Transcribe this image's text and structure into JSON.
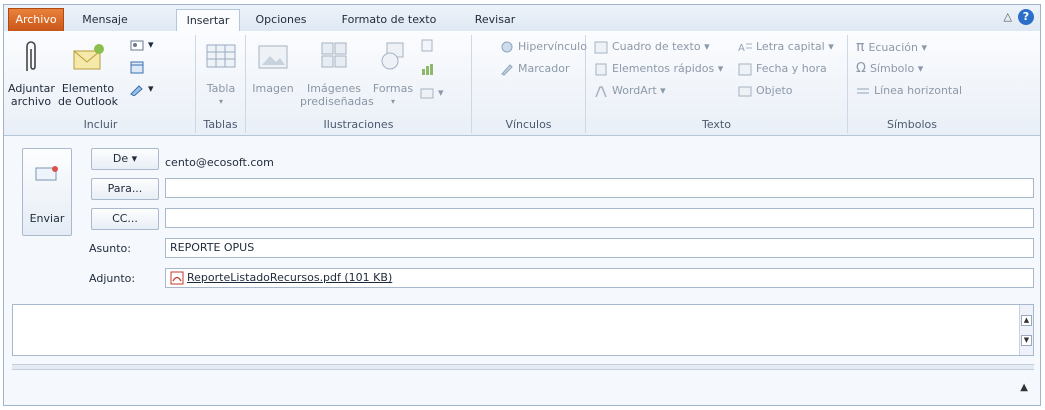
{
  "tabs": [
    {
      "label": "Archivo",
      "kind": "file"
    },
    {
      "label": "Mensaje"
    },
    {
      "label": "Insertar",
      "active": true
    },
    {
      "label": "Opciones"
    },
    {
      "label": "Formato de texto"
    },
    {
      "label": "Revisar"
    }
  ],
  "ribbon": {
    "incluir": {
      "label": "Incluir",
      "adjuntar": "Adjuntar archivo",
      "adjuntar_l1": "Adjuntar",
      "adjuntar_l2": "archivo",
      "elemento_l1": "Elemento",
      "elemento_l2": "de Outlook"
    },
    "tablas": {
      "label": "Tablas",
      "tabla": "Tabla"
    },
    "ilustraciones": {
      "label": "Ilustraciones",
      "imagen": "Imagen",
      "imagenes_l1": "Imágenes",
      "imagenes_l2": "prediseñadas",
      "formas": "Formas"
    },
    "vinculos": {
      "label": "Vínculos",
      "hipervinculo": "Hipervínculo",
      "marcador": "Marcador"
    },
    "texto": {
      "label": "Texto",
      "cuadro": "Cuadro de texto",
      "rapidos": "Elementos rápidos",
      "wordart": "WordArt",
      "letra": "Letra capital",
      "fecha": "Fecha y hora",
      "objeto": "Objeto"
    },
    "simbolos": {
      "label": "Símbolos",
      "ecuacion": "Ecuación",
      "simbolo": "Símbolo",
      "linea": "Línea horizontal"
    }
  },
  "message": {
    "send_label": "Enviar",
    "from_button": "De",
    "from_value": "cento@ecosoft.com",
    "to_button": "Para...",
    "to_value": "",
    "cc_button": "CC...",
    "cc_value": "",
    "subject_label": "Asunto:",
    "subject_value": "REPORTE OPUS",
    "attach_label": "Adjunto:",
    "attachment": "ReporteListadoRecursos.pdf (101 KB)"
  }
}
